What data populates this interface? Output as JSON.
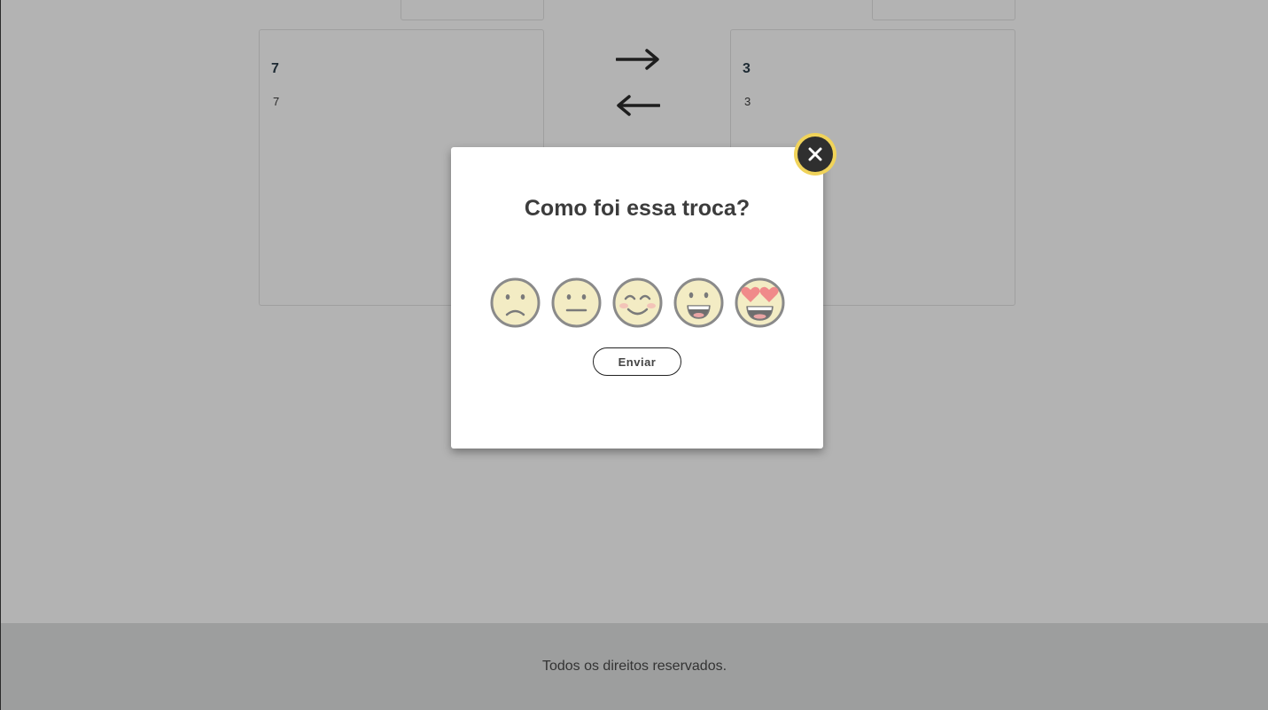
{
  "cards": {
    "left": {
      "title": "7",
      "subtitle": "7"
    },
    "right": {
      "title": "3",
      "subtitle": "3"
    }
  },
  "icons": {
    "arrow_right": "arrow-right-icon",
    "arrow_left": "arrow-left-icon",
    "close": "close-icon",
    "emojis": [
      "sad-face-icon",
      "neutral-face-icon",
      "smiling-face-icon",
      "grinning-face-icon",
      "heart-eyes-face-icon"
    ]
  },
  "modal": {
    "title": "Como foi essa troca?",
    "send_label": "Enviar",
    "close_symbol": "✕"
  },
  "footer": {
    "text": "Todos os direitos reservados."
  },
  "colors": {
    "overlay": "#b3b3b3",
    "footer": "#9d9e9e",
    "close_ring": "#f0d35a",
    "close_fill": "#2f2f2f",
    "emoji_face": "#f3ecc4",
    "emoji_outline": "#8a8a8a",
    "heart": "#f08a8a"
  }
}
